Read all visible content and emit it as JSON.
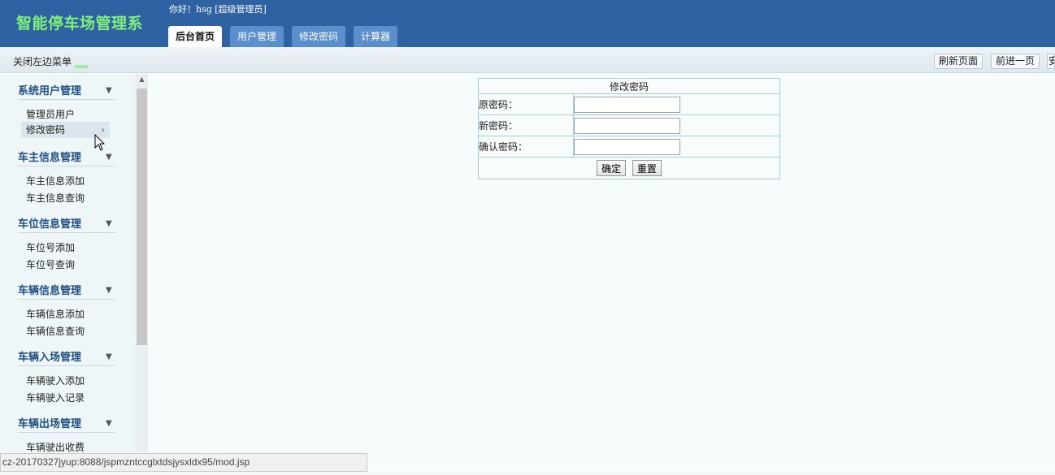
{
  "header": {
    "app_title": "智能停车场管理系",
    "greeting": "你好！hsg [超级管理员]",
    "tabs": [
      {
        "label": "后台首页",
        "active": true
      },
      {
        "label": "用户管理",
        "active": false
      },
      {
        "label": "修改密码",
        "active": false
      },
      {
        "label": "计算器",
        "active": false
      }
    ]
  },
  "toolbar": {
    "close_menu": "关闭左边菜单",
    "refresh": "刷新页面",
    "forward": "前进一页",
    "more": "安"
  },
  "sidebar": {
    "groups": [
      {
        "title": "系统用户管理",
        "items": [
          "管理员用户",
          "修改密码"
        ]
      },
      {
        "title": "车主信息管理",
        "items": [
          "车主信息添加",
          "车主信息查询"
        ]
      },
      {
        "title": "车位信息管理",
        "items": [
          "车位号添加",
          "车位号查询"
        ]
      },
      {
        "title": "车辆信息管理",
        "items": [
          "车辆信息添加",
          "车辆信息查询"
        ]
      },
      {
        "title": "车辆入场管理",
        "items": [
          "车辆驶入添加",
          "车辆驶入记录"
        ]
      },
      {
        "title": "车辆出场管理",
        "items": [
          "车辆驶出收费"
        ]
      }
    ],
    "selected_item": "修改密码"
  },
  "form": {
    "title": "修改密码",
    "old_label": "原密码：",
    "new_label": "新密码：",
    "confirm_label": "确认密码：",
    "old_value": "",
    "new_value": "",
    "confirm_value": "",
    "submit": "确定",
    "reset": "重置"
  },
  "status": {
    "url": "cz-20170327jyup:8088/jspmzntccglxtdsjysxldx95/mod.jsp"
  },
  "colors": {
    "header_bg": "#2f62a2",
    "title_green": "#7ff07a",
    "tab_bg": "#5a8ecd",
    "sidebar_title": "#1f4f85"
  }
}
